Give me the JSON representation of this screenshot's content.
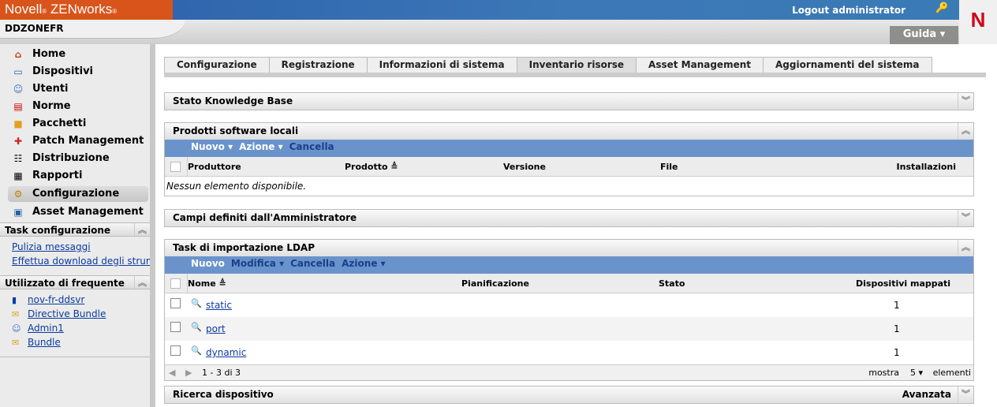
{
  "header": {
    "brand": "Novell",
    "brand_reg": "®",
    "product": "ZENworks",
    "logout": "Logout administrator",
    "zone": "DDZONEFR",
    "help": "Guida ▾",
    "logo": "N"
  },
  "sidebar": {
    "nav": [
      {
        "label": "Home",
        "icon": "home-icon"
      },
      {
        "label": "Dispositivi",
        "icon": "devices-icon"
      },
      {
        "label": "Utenti",
        "icon": "users-icon"
      },
      {
        "label": "Norme",
        "icon": "policies-icon"
      },
      {
        "label": "Pacchetti",
        "icon": "bundles-icon"
      },
      {
        "label": "Patch Management",
        "icon": "patch-icon"
      },
      {
        "label": "Distribuzione",
        "icon": "deployment-icon"
      },
      {
        "label": "Rapporti",
        "icon": "reports-icon"
      },
      {
        "label": "Configurazione",
        "icon": "configuration-icon",
        "selected": true
      },
      {
        "label": "Asset Management",
        "icon": "asset-icon"
      }
    ],
    "task_title": "Task configurazione",
    "tasks": [
      "Pulizia messaggi",
      "Effettua download degli strumenti"
    ],
    "freq_title": "Utilizzato di frequente",
    "frequent": [
      {
        "label": "nov-fr-ddsvr",
        "icon": "server-icon"
      },
      {
        "label": "Directive Bundle",
        "icon": "bundle-icon"
      },
      {
        "label": "Admin1",
        "icon": "user-icon"
      },
      {
        "label": "Bundle",
        "icon": "bundle-icon"
      }
    ]
  },
  "tabs": [
    "Configurazione",
    "Registrazione",
    "Informazioni di sistema",
    "Inventario risorse",
    "Asset Management",
    "Aggiornamenti del sistema"
  ],
  "active_tab": "Inventario risorse",
  "panels": {
    "kb": {
      "title": "Stato Knowledge Base"
    },
    "software": {
      "title": "Prodotti software locali",
      "toolbar": [
        "Nuovo ▾",
        "Azione ▾",
        "Cancella"
      ],
      "columns": [
        "Produttore",
        "Prodotto ≜",
        "Versione",
        "File",
        "Installazioni"
      ],
      "empty": "Nessun elemento disponibile."
    },
    "fields": {
      "title": "Campi definiti dall'Amministratore"
    },
    "ldap": {
      "title": "Task di importazione LDAP",
      "toolbar": [
        "Nuovo",
        "Modifica ▾",
        "Cancella",
        "Azione ▾"
      ],
      "columns": [
        "Nome ≜",
        "Pianificazione",
        "Stato",
        "Dispositivi mappati"
      ],
      "rows": [
        {
          "name": "static",
          "mapped": "1"
        },
        {
          "name": "port",
          "mapped": "1"
        },
        {
          "name": "dynamic",
          "mapped": "1"
        }
      ],
      "range": "1 - 3 di 3",
      "show": "mostra",
      "per_page": "5 ▾",
      "items": "elementi"
    },
    "search": {
      "title": "Ricerca dispositivo",
      "advanced": "Avanzata"
    }
  }
}
